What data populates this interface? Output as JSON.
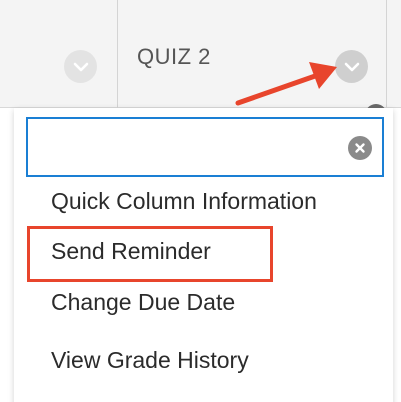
{
  "columns": {
    "quiz": {
      "title": "QUIZ 2"
    }
  },
  "menu": {
    "search": {
      "value": "",
      "placeholder": ""
    },
    "items": [
      {
        "label": "Quick Column Information"
      },
      {
        "label": "Send Reminder",
        "highlighted": true
      },
      {
        "label": "Change Due Date"
      },
      {
        "label": "View Grade History"
      }
    ]
  },
  "annotation": {
    "arrow_color": "#e8452c",
    "highlight_color": "#e8452c"
  },
  "icons": {
    "column_menu": "chevron-down-icon",
    "clear": "clear-x-icon"
  },
  "colors": {
    "search_border": "#1a7fd4",
    "header_bg": "#f4f4f4"
  }
}
